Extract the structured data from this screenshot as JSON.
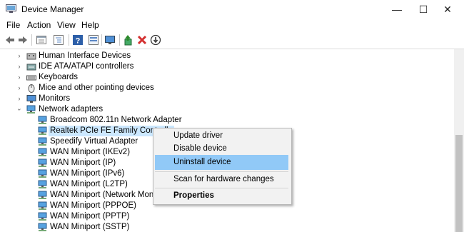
{
  "window": {
    "title": "Device Manager",
    "minimize_glyph": "—",
    "maximize_glyph": "☐",
    "close_glyph": "✕"
  },
  "menu": [
    "File",
    "Action",
    "View",
    "Help"
  ],
  "toolbar": [
    "back-icon",
    "forward-icon",
    "properties-icon",
    "tree-view-icon",
    "help-icon",
    "console-icon",
    "monitor-icon",
    "update-driver-icon",
    "uninstall-icon",
    "scan-hardware-icon"
  ],
  "tree": {
    "categories": [
      {
        "label": "Human Interface Devices",
        "icon": "hid-icon"
      },
      {
        "label": "IDE ATA/ATAPI controllers",
        "icon": "ide-icon"
      },
      {
        "label": "Keyboards",
        "icon": "keyboard-icon"
      },
      {
        "label": "Mice and other pointing devices",
        "icon": "mouse-icon"
      },
      {
        "label": "Monitors",
        "icon": "monitor-icon"
      },
      {
        "label": "Network adapters",
        "icon": "network-icon"
      }
    ],
    "network_children": [
      "Broadcom 802.11n Network Adapter",
      "Realtek PCIe FE Family Controlle",
      "Speedify Virtual Adapter",
      "WAN Miniport (IKEv2)",
      "WAN Miniport (IP)",
      "WAN Miniport (IPv6)",
      "WAN Miniport (L2TP)",
      "WAN Miniport (Network Monito",
      "WAN Miniport (PPPOE)",
      "WAN Miniport (PPTP)",
      "WAN Miniport (SSTP)"
    ],
    "selected": "Realtek PCIe FE Family Controlle"
  },
  "context_menu": {
    "items": [
      "Update driver",
      "Disable device",
      "Uninstall device",
      "Scan for hardware changes",
      "Properties"
    ],
    "highlighted": "Uninstall device"
  },
  "colors": {
    "selection": "#cce8ff",
    "menu_highlight": "#91c9f7",
    "delete_red": "#d32f2f"
  }
}
